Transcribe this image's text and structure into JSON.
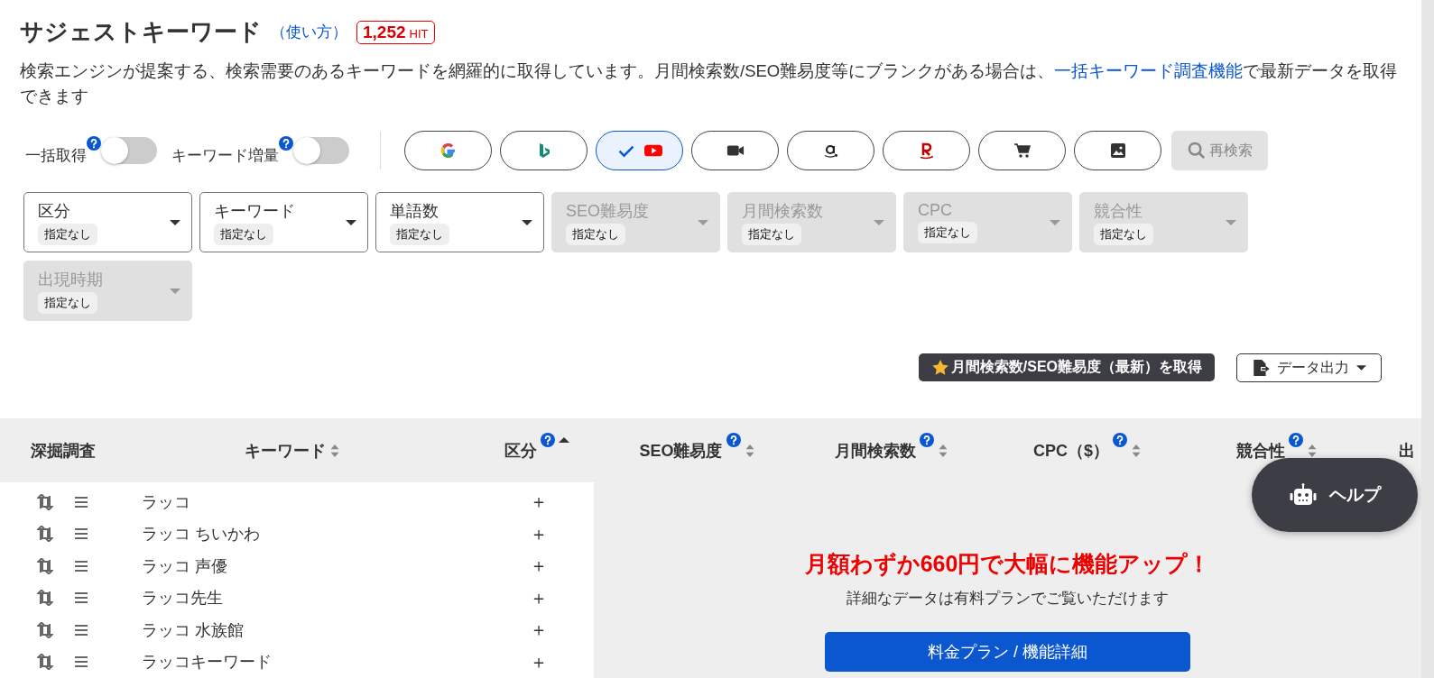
{
  "header": {
    "title": "サジェストキーワード",
    "howto_link": "（使い方）",
    "hit_count": "1,252",
    "hit_unit": "HIT"
  },
  "description": {
    "before": "検索エンジンが提案する、検索需要のあるキーワードを網羅的に取得しています。月間検索数/SEO難易度等にブランクがある場合は、",
    "link": "一括キーワード調査機能",
    "after": "で最新データを取得できます"
  },
  "toggles": [
    {
      "label": "一括取得",
      "on": false
    },
    {
      "label": "キーワード増量",
      "on": false
    }
  ],
  "engines": [
    {
      "kind": "google",
      "selected": false
    },
    {
      "kind": "bing",
      "selected": false
    },
    {
      "kind": "youtube",
      "selected": true
    },
    {
      "kind": "video",
      "selected": false
    },
    {
      "kind": "amazon",
      "selected": false
    },
    {
      "kind": "rakuten",
      "selected": false
    },
    {
      "kind": "shopping",
      "selected": false
    },
    {
      "kind": "image",
      "selected": false
    }
  ],
  "research_button": {
    "label": "再検索",
    "disabled": true
  },
  "filters": [
    {
      "label": "区分",
      "value": "指定なし",
      "disabled": false
    },
    {
      "label": "キーワード",
      "value": "指定なし",
      "disabled": false
    },
    {
      "label": "単語数",
      "value": "指定なし",
      "disabled": false
    },
    {
      "label": "SEO難易度",
      "value": "指定なし",
      "disabled": true
    },
    {
      "label": "月間検索数",
      "value": "指定なし",
      "disabled": true
    },
    {
      "label": "CPC",
      "value": "指定なし",
      "disabled": true
    },
    {
      "label": "競合性",
      "value": "指定なし",
      "disabled": true
    },
    {
      "label": "出現時期",
      "value": "指定なし",
      "disabled": true
    }
  ],
  "fetch_button": "月間検索数/SEO難易度（最新）を取得",
  "export_button": "データ出力",
  "table": {
    "columns": [
      {
        "label": "深掘調査",
        "help": false,
        "sortable": false
      },
      {
        "label": "キーワード",
        "help": false,
        "sortable": true,
        "ascending": false
      },
      {
        "label": "区分",
        "help": true,
        "sortable": true,
        "ascending": true
      },
      {
        "label": "SEO難易度",
        "help": true,
        "sortable": true,
        "ascending": false
      },
      {
        "label": "月間検索数",
        "help": true,
        "sortable": true,
        "ascending": false
      },
      {
        "label": "CPC（$）",
        "help": true,
        "sortable": true,
        "ascending": false
      },
      {
        "label": "競合性",
        "help": true,
        "sortable": true,
        "ascending": false
      },
      {
        "label": "出",
        "help": false,
        "sortable": false
      }
    ],
    "rows": [
      {
        "keyword": "ラッコ",
        "segment": "＋"
      },
      {
        "keyword": "ラッコ ちいかわ",
        "segment": "＋"
      },
      {
        "keyword": "ラッコ 声優",
        "segment": "＋"
      },
      {
        "keyword": "ラッコ先生",
        "segment": "＋"
      },
      {
        "keyword": "ラッコ 水族館",
        "segment": "＋"
      },
      {
        "keyword": "ラッコキーワード",
        "segment": "＋"
      }
    ]
  },
  "upsell": {
    "headline": "月額わずか660円で大幅に機能アップ！",
    "subtext": "詳細なデータは有料プランでご覧いただけます",
    "button": "料金プラン / 機能詳細"
  },
  "help_button": "ヘルプ"
}
